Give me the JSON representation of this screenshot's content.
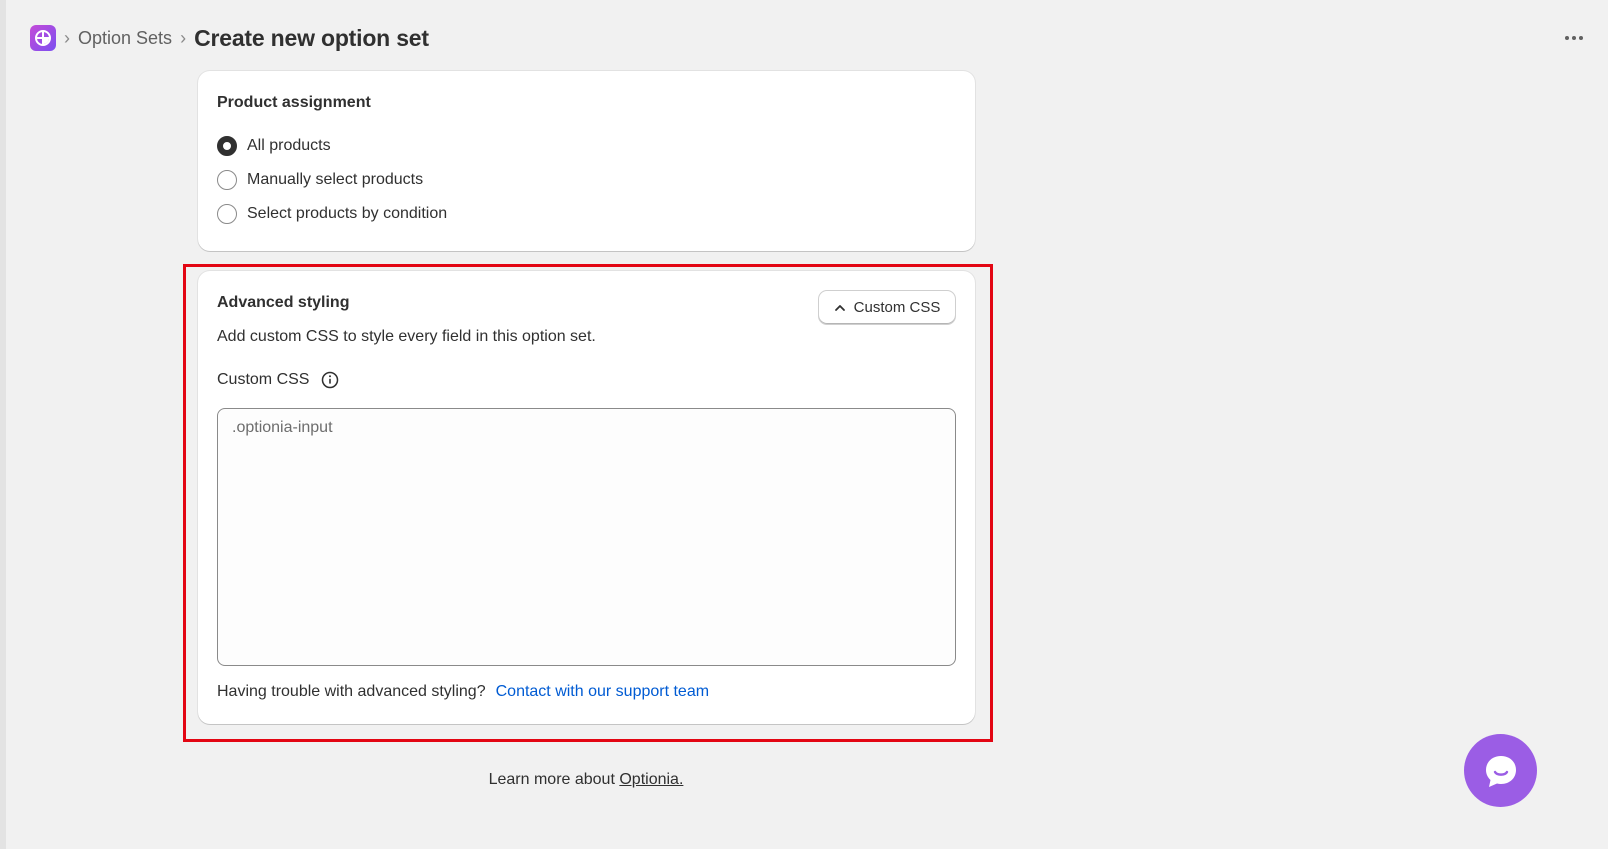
{
  "header": {
    "breadcrumb": "Option Sets",
    "title": "Create new option set",
    "app_icon": "optionia-logo-icon",
    "more_icon": "more-horizontal-icon"
  },
  "product_assignment": {
    "title": "Product assignment",
    "options": [
      {
        "label": "All products",
        "selected": true
      },
      {
        "label": "Manually select products",
        "selected": false
      },
      {
        "label": "Select products by condition",
        "selected": false
      }
    ]
  },
  "advanced_styling": {
    "title": "Advanced styling",
    "toggle_label": "Custom CSS",
    "toggle_icon": "chevron-up-icon",
    "description": "Add custom CSS to style every field in this option set.",
    "field_label": "Custom CSS",
    "info_icon": "info-icon",
    "textarea_placeholder": ".optionia-input",
    "textarea_value": "",
    "help_text": "Having trouble with advanced styling?",
    "support_link": "Contact with our support team"
  },
  "footer": {
    "prefix": "Learn more about ",
    "link": "Optionia."
  },
  "chat": {
    "icon": "chat-bubble-icon"
  },
  "colors": {
    "accent": "#9b5de5",
    "link": "#005bd3",
    "highlight": "#e30613",
    "background": "#f1f1f1"
  }
}
